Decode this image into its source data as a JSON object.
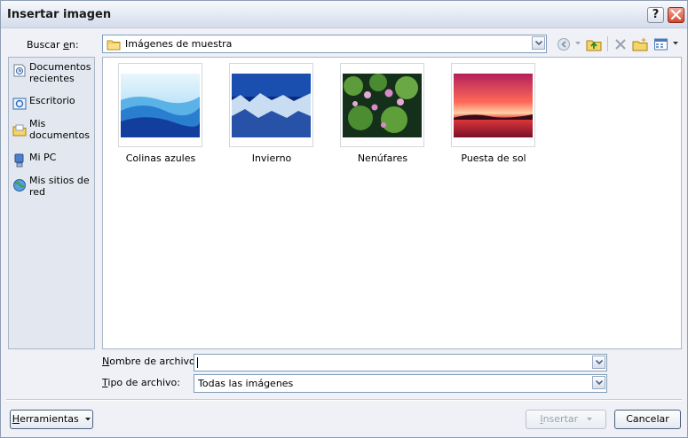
{
  "dialog": {
    "title": "Insertar imagen",
    "help_label": "?",
    "close_label": "✕"
  },
  "lookin": {
    "label_prefix": "Buscar ",
    "label_access": "e",
    "label_suffix": "n:",
    "value": "Imágenes de muestra"
  },
  "toolbar": {
    "icons": [
      "back-icon",
      "up-folder-icon",
      "delete-icon",
      "new-folder-icon",
      "views-icon"
    ]
  },
  "places": [
    {
      "label": "Documentos recientes",
      "icon": "recent-documents-icon"
    },
    {
      "label": "Escritorio",
      "icon": "desktop-icon"
    },
    {
      "label": "Mis documentos",
      "icon": "my-documents-icon"
    },
    {
      "label": "Mi PC",
      "icon": "my-computer-icon"
    },
    {
      "label": "Mis sitios de red",
      "icon": "network-places-icon"
    }
  ],
  "files": [
    {
      "name": "Colinas azules"
    },
    {
      "name": "Invierno"
    },
    {
      "name": "Nenúfares"
    },
    {
      "name": "Puesta de sol"
    }
  ],
  "filename": {
    "label_access": "N",
    "label_rest": "ombre de archivo:",
    "value": ""
  },
  "filetype": {
    "label_access": "T",
    "label_rest": "ipo de archivo:",
    "value": "Todas las imágenes"
  },
  "buttons": {
    "tools_access": "H",
    "tools_rest": "erramientas",
    "insert_access": "I",
    "insert_rest": "nsertar",
    "cancel": "Cancelar"
  },
  "colors": {
    "accent": "#0a246a",
    "close_red": "#d3472f"
  }
}
